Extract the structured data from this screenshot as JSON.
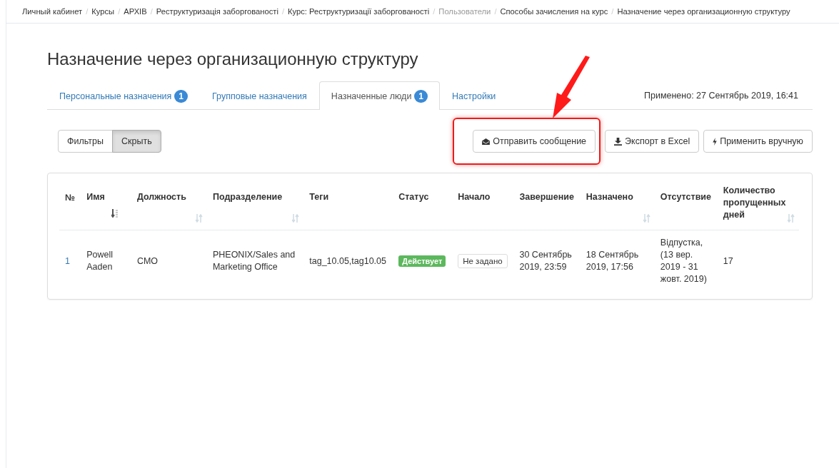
{
  "breadcrumb": [
    {
      "label": "Личный кабинет",
      "disabled": false
    },
    {
      "separator": "/",
      "label": "Курсы",
      "disabled": false
    },
    {
      "separator": "/",
      "label": "АРХІВ",
      "disabled": false
    },
    {
      "separator": "/",
      "label": "Реструктуризація заборгованості",
      "disabled": false
    },
    {
      "separator": "/",
      "label": "Курс: Реструктуризації заборгованості",
      "disabled": false
    },
    {
      "separator": "/",
      "label": "Пользователи",
      "disabled": true
    },
    {
      "separator": "/",
      "label": "Способы зачисления на курс",
      "disabled": false
    },
    {
      "separator": "/",
      "label": "Назначение через организационную структуру",
      "disabled": false
    }
  ],
  "title": "Назначение через организационную структуру",
  "tabs": [
    {
      "label": "Персональные назначения",
      "badge": "1",
      "selected": false
    },
    {
      "label": "Групповые назначения",
      "selected": false
    },
    {
      "label": "Назначенные люди",
      "badge": "1",
      "selected": true
    },
    {
      "label": "Настройки",
      "selected": false
    }
  ],
  "applied": "Применено: 27 Сентябрь 2019, 16:41",
  "filter_buttons": [
    {
      "label": "Фильтры",
      "selected": false
    },
    {
      "label": "Скрыть",
      "selected": true
    }
  ],
  "actions": [
    {
      "label": "Отправить сообщение",
      "kind": "message",
      "highlighted": true
    },
    {
      "label": "Экспорт в Excel",
      "kind": "export",
      "highlighted": false
    },
    {
      "label": "Применить вручную",
      "kind": "apply",
      "highlighted": false
    }
  ],
  "table": {
    "columns": [
      {
        "label": "№",
        "sortable": false
      },
      {
        "label": "Имя",
        "sortable": true,
        "sorted": true
      },
      {
        "label": "Должность",
        "sortable": true,
        "sorted": false
      },
      {
        "label": "Подразделение",
        "sortable": true,
        "sorted": false
      },
      {
        "label": "Теги",
        "sortable": false
      },
      {
        "label": "Статус",
        "sortable": false
      },
      {
        "label": "Начало",
        "sortable": false
      },
      {
        "label": "Завершение",
        "sortable": false
      },
      {
        "label": "Назначено",
        "sortable": true,
        "sorted": false
      },
      {
        "label": "Отсутствие",
        "sortable": false
      },
      {
        "label": "Количество пропущенных дней",
        "sortable": true,
        "sorted": false
      }
    ],
    "rows": [
      {
        "cells": [
          {
            "kind": "link",
            "text": "1"
          },
          {
            "kind": "text",
            "text": "Powell Aaden"
          },
          {
            "kind": "text",
            "text": "CMO"
          },
          {
            "kind": "text",
            "text": "PHEONIX/Sales and Marketing Office"
          },
          {
            "kind": "text",
            "text": "tag_10.05,tag10.05"
          },
          {
            "kind": "badge",
            "text": "Действует"
          },
          {
            "kind": "label",
            "text": "Не задано"
          },
          {
            "kind": "text",
            "text": "30 Сентябрь 2019, 23:59"
          },
          {
            "kind": "text",
            "text": "18 Сентябрь 2019, 17:56"
          },
          {
            "kind": "text",
            "text": "Відпустка, (13 вер. 2019 - 31 жовт. 2019)"
          },
          {
            "kind": "text",
            "text": "17"
          }
        ]
      }
    ]
  }
}
